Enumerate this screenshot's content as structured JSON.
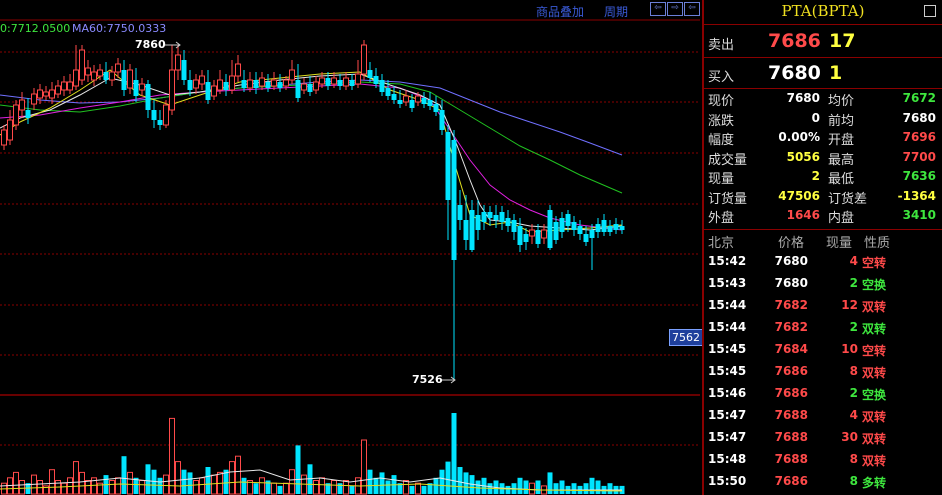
{
  "toolbar": {
    "overlay_label": "商品叠加",
    "period_label": "周期"
  },
  "ma_labels": {
    "ma_first": "0:7712.0500",
    "ma60": "MA60:7750.0333"
  },
  "price_labels": {
    "high": "7860",
    "low": "7526",
    "current_axis": "7562"
  },
  "colors": {
    "up": "#ff4a4a",
    "down": "#00e5ff",
    "grid": "#8a0000"
  },
  "quote": {
    "title": "PTA(BPTA)",
    "ask_label": "卖出",
    "ask_price": "7686",
    "ask_vol": "17",
    "bid_label": "买入",
    "bid_price": "7680",
    "bid_vol": "1",
    "stats_left": [
      {
        "label": "现价",
        "value": "7680",
        "color": "wht"
      },
      {
        "label": "涨跌",
        "value": "0",
        "color": "wht"
      },
      {
        "label": "幅度",
        "value": "0.00%",
        "color": "wht"
      },
      {
        "label": "成交量",
        "value": "5056",
        "color": "yel"
      },
      {
        "label": "现量",
        "value": "2",
        "color": "yel"
      },
      {
        "label": "订货量",
        "value": "47506",
        "color": "yel"
      },
      {
        "label": "外盘",
        "value": "1646",
        "color": "red"
      }
    ],
    "stats_right": [
      {
        "label": "均价",
        "value": "7672",
        "color": "grn"
      },
      {
        "label": "前均",
        "value": "7680",
        "color": "wht"
      },
      {
        "label": "开盘",
        "value": "7696",
        "color": "red"
      },
      {
        "label": "最高",
        "value": "7700",
        "color": "red"
      },
      {
        "label": "最低",
        "value": "7636",
        "color": "grn"
      },
      {
        "label": "订货差",
        "value": "-1364",
        "color": "yel"
      },
      {
        "label": "内盘",
        "value": "3410",
        "color": "grn"
      }
    ],
    "tick_headers": [
      "北京",
      "价格",
      "现量",
      "性质"
    ],
    "ticks": [
      {
        "time": "15:42",
        "price": "7680",
        "pc": "wht",
        "vol": "4",
        "vc": "red",
        "nature": "空转",
        "nc": "red"
      },
      {
        "time": "15:43",
        "price": "7680",
        "pc": "wht",
        "vol": "2",
        "vc": "grn",
        "nature": "空换",
        "nc": "grn"
      },
      {
        "time": "15:44",
        "price": "7682",
        "pc": "red",
        "vol": "12",
        "vc": "red",
        "nature": "双转",
        "nc": "red"
      },
      {
        "time": "15:44",
        "price": "7682",
        "pc": "red",
        "vol": "2",
        "vc": "grn",
        "nature": "双转",
        "nc": "grn"
      },
      {
        "time": "15:45",
        "price": "7684",
        "pc": "red",
        "vol": "10",
        "vc": "red",
        "nature": "空转",
        "nc": "red"
      },
      {
        "time": "15:45",
        "price": "7686",
        "pc": "red",
        "vol": "8",
        "vc": "red",
        "nature": "双转",
        "nc": "red"
      },
      {
        "time": "15:46",
        "price": "7686",
        "pc": "red",
        "vol": "2",
        "vc": "grn",
        "nature": "空换",
        "nc": "grn"
      },
      {
        "time": "15:47",
        "price": "7688",
        "pc": "red",
        "vol": "4",
        "vc": "red",
        "nature": "双转",
        "nc": "red"
      },
      {
        "time": "15:47",
        "price": "7688",
        "pc": "red",
        "vol": "30",
        "vc": "red",
        "nature": "双转",
        "nc": "red"
      },
      {
        "time": "15:48",
        "price": "7688",
        "pc": "red",
        "vol": "8",
        "vc": "red",
        "nature": "双转",
        "nc": "red"
      },
      {
        "time": "15:50",
        "price": "7686",
        "pc": "red",
        "vol": "8",
        "vc": "grn",
        "nature": "多转",
        "nc": "grn"
      }
    ]
  }
}
